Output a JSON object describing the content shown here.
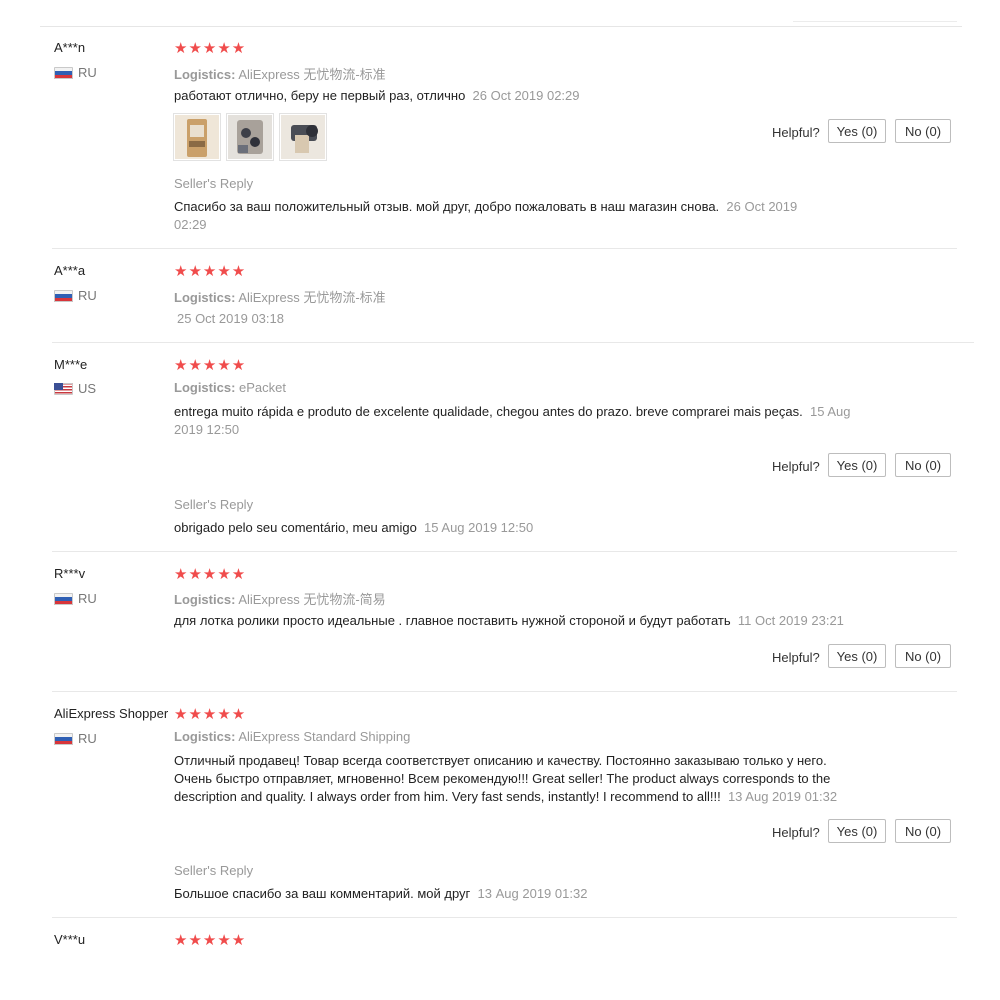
{
  "helpful_label": "Helpful?",
  "logistics_label": "Logistics:",
  "seller_reply_label": "Seller's Reply",
  "star_glyphs": "★★★★★",
  "reviews": [
    {
      "name": "A***n",
      "country": "RU",
      "rating": 5,
      "logistics": "AliExpress 无忧物流-标准",
      "text": "работают отлично, беру не первый раз, отлично",
      "date": "26 Oct 2019 02:29",
      "yes": "Yes (0)",
      "no": "No (0)",
      "reply_text": "Спасибо за ваш положительный отзыв. мой друг, добро пожаловать в наш магазин снова.",
      "reply_date": "26 Oct 2019 02:29"
    },
    {
      "name": "A***a",
      "country": "RU",
      "rating": 5,
      "logistics": "AliExpress 无忧物流-标准",
      "date": "25 Oct 2019 03:18"
    },
    {
      "name": "M***e",
      "country": "US",
      "rating": 5,
      "logistics": "ePacket",
      "text": "entrega muito rápida e produto de excelente qualidade, chegou antes do prazo. breve comprarei mais peças.",
      "date": "15 Aug 2019 12:50",
      "yes": "Yes (0)",
      "no": "No (0)",
      "reply_text": "obrigado pelo seu comentário, meu amigo",
      "reply_date": "15 Aug 2019 12:50"
    },
    {
      "name": "R***v",
      "country": "RU",
      "rating": 5,
      "logistics": "AliExpress 无忧物流-简易",
      "text": "для лотка ролики просто идеальные . главное поставить нужной стороной и будут работать",
      "date": "11 Oct 2019 23:21",
      "yes": "Yes (0)",
      "no": "No (0)"
    },
    {
      "name": "AliExpress Shopper",
      "country": "RU",
      "rating": 5,
      "logistics": "AliExpress Standard Shipping",
      "text": "Отличный продавец! Товар всегда соответствует описанию и качеству. Постоянно заказываю только у него. Очень быстро отправляет, мгновенно! Всем рекомендую!!! Great seller! The product always corresponds to the description and quality. I always order from him. Very fast sends, instantly! I recommend to all!!!",
      "date": "13 Aug 2019 01:32",
      "yes": "Yes (0)",
      "no": "No (0)",
      "reply_text": "Большое спасибо за ваш комментарий. мой друг",
      "reply_date": "13 Aug 2019 01:32"
    },
    {
      "name": "V***u",
      "rating": 5
    }
  ]
}
